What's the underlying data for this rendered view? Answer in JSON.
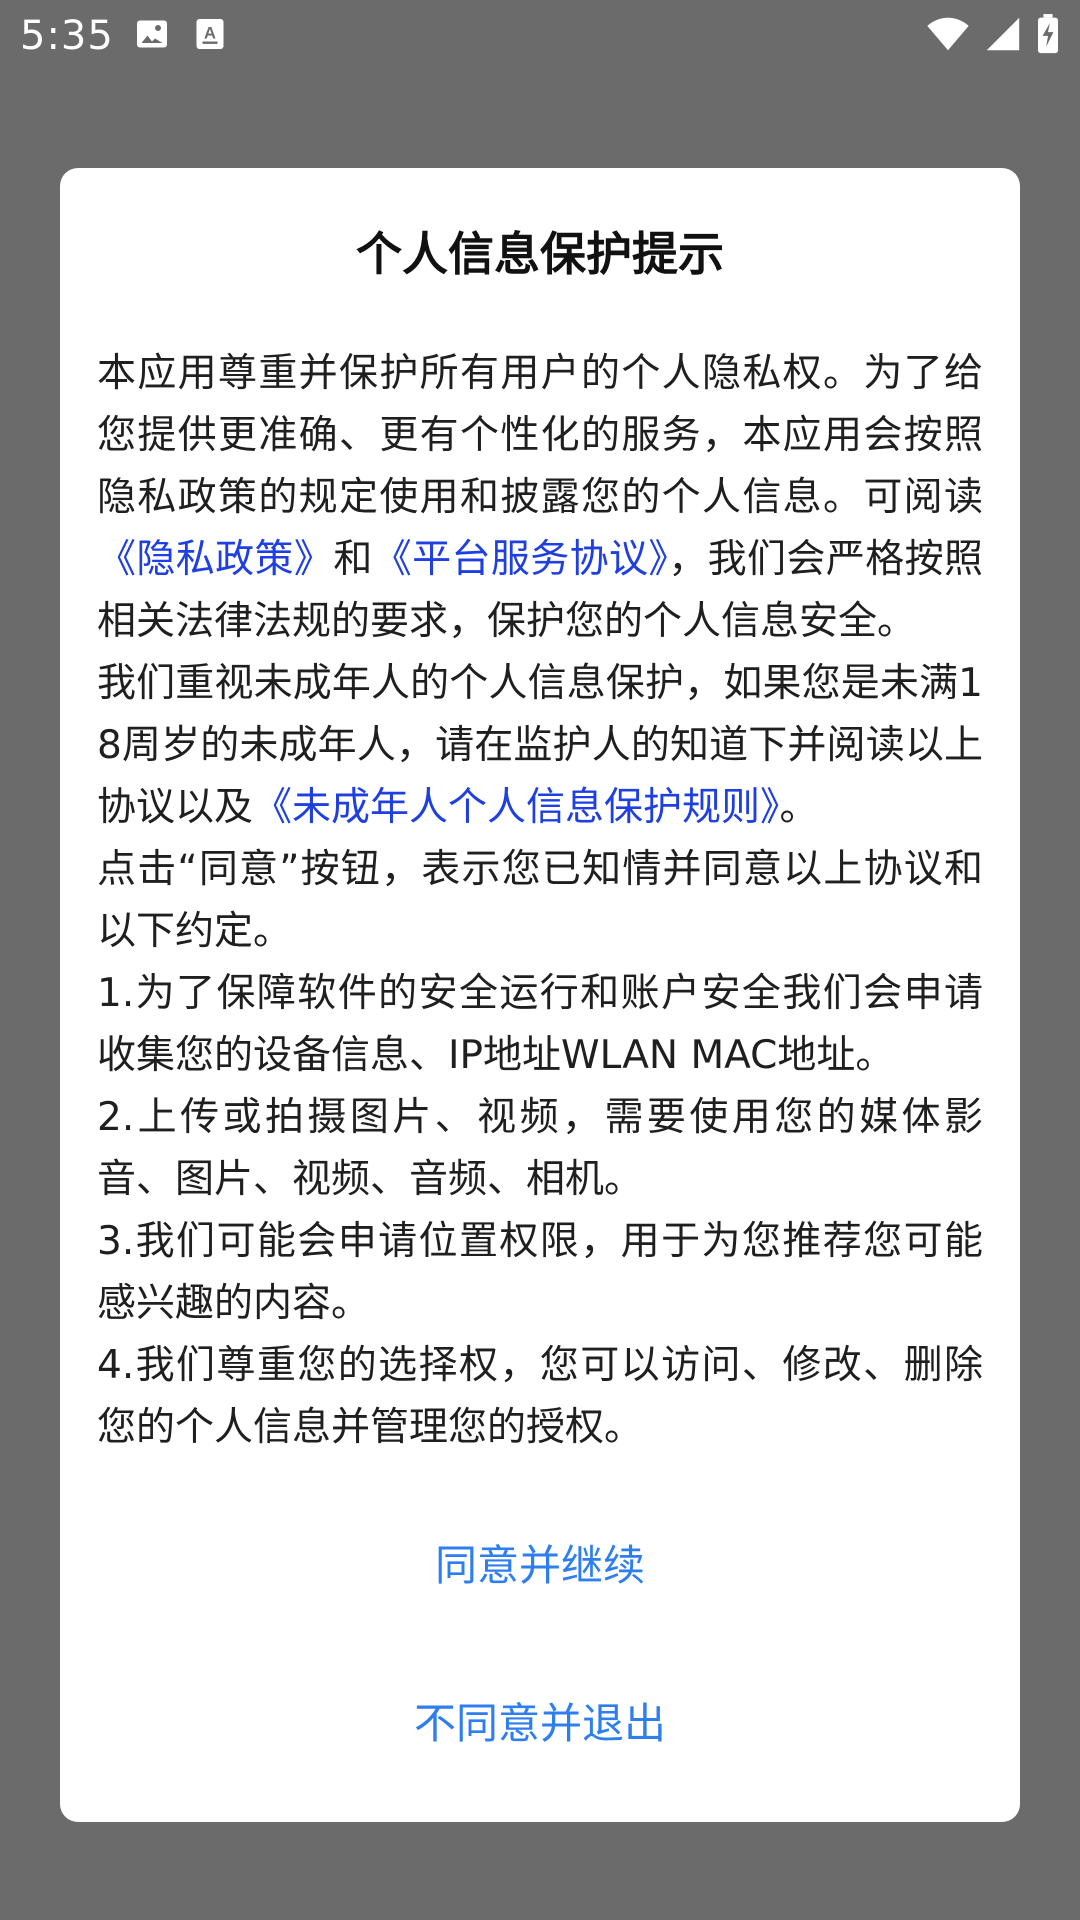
{
  "status_bar": {
    "time": "5:35",
    "left_icons": [
      "image-icon",
      "text-a-icon"
    ],
    "right_icons": [
      "wifi-icon",
      "signal-icon",
      "battery-charging-icon"
    ]
  },
  "dialog": {
    "title": "个人信息保护提示",
    "para1": {
      "t1": "本应用尊重并保护所有用户的个人隐私权。为了给您提供更准确、更有个性化的服务，本应用会按照隐私政策的规定使用和披露您的个人信息。可阅读",
      "link1": "《隐私政策》",
      "t2": "和",
      "link2": "《平台服务协议》",
      "t3": "，我们会严格按照相关法律法规的要求，保护您的个人信息安全。"
    },
    "para2": {
      "t1": "我们重视未成年人的个人信息保护，如果您是未满18周岁的未成年人，请在监护人的知道下并阅读以上协议以及",
      "link1": "《未成年人个人信息保护规则》",
      "t2": "。"
    },
    "para3": "点击“同意”按钮，表示您已知情并同意以上协议和以下约定。",
    "item1": "1.为了保障软件的安全运行和账户安全我们会申请收集您的设备信息、IP地址WLAN MAC地址。",
    "item2": "2.上传或拍摄图片、视频，需要使用您的媒体影音、图片、视频、音频、相机。",
    "item3": "3.我们可能会申请位置权限，用于为您推荐您可能感兴趣的内容。",
    "item4": "4.我们尊重您的选择权，您可以访问、修改、删除您的个人信息并管理您的授权。",
    "agree_label": "同意并继续",
    "disagree_label": "不同意并退出"
  },
  "colors": {
    "overlay": "#6b6b6b",
    "link": "#1f3fe0",
    "button": "#2f7ef0"
  }
}
